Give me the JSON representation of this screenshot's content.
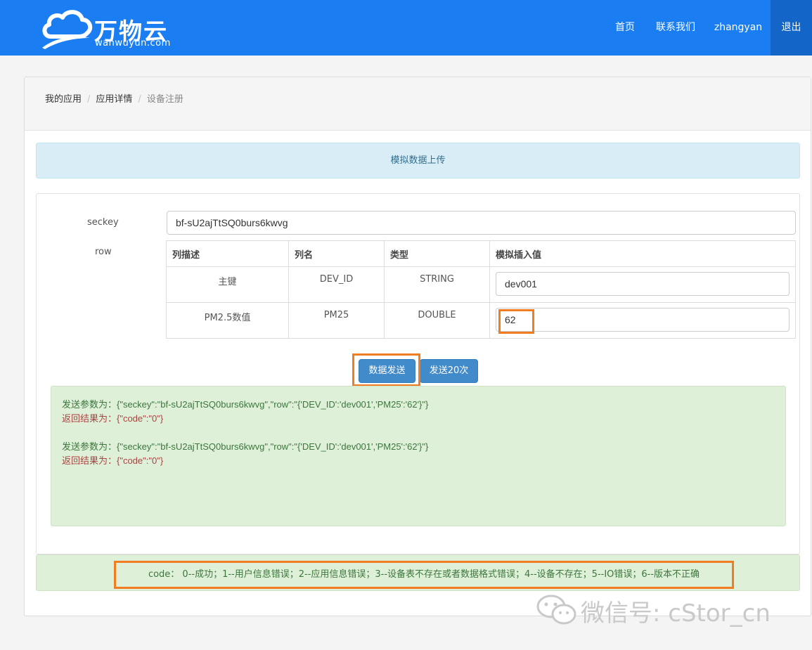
{
  "brand": {
    "name": "万物云",
    "domain": "wanwuyun.com",
    "color": "#1a7ef2"
  },
  "nav": {
    "home": "首页",
    "contact": "联系我们",
    "user": "zhangyan",
    "logout": "退出"
  },
  "breadcrumb": {
    "items": [
      "我的应用",
      "应用详情",
      "设备注册"
    ],
    "separator": "/"
  },
  "panel_title": "模拟数据上传",
  "form": {
    "seckey_label": "seckey",
    "seckey_value": "bf-sU2ajTtSQ0burs6kwvg",
    "row_label": "row",
    "columns": [
      "列描述",
      "列名",
      "类型",
      "模拟插入值"
    ],
    "rows": [
      {
        "desc": "主键",
        "name": "DEV_ID",
        "type": "STRING",
        "value": "dev001"
      },
      {
        "desc": "PM2.5数值",
        "name": "PM25",
        "type": "DOUBLE",
        "value": "62"
      }
    ]
  },
  "buttons": {
    "send": "数据发送",
    "send20": "发送20次"
  },
  "log": [
    {
      "params": "发送参数为：{\"seckey\":\"bf-sU2ajTtSQ0burs6kwvg\",\"row\":\"{'DEV_ID':'dev001','PM25':'62'}\"}",
      "result": "返回结果为：{\"code\":\"0\"}"
    },
    {
      "params": "发送参数为：{\"seckey\":\"bf-sU2ajTtSQ0burs6kwvg\",\"row\":\"{'DEV_ID':'dev001','PM25':'62'}\"}",
      "result": "返回结果为：{\"code\":\"0\"}"
    }
  ],
  "code_legend": "code： 0--成功；1--用户信息错误；2--应用信息错误；3--设备表不存在或者数据格式错误；4--设备不存在；5--IO错误；6--版本不正确",
  "watermark": "微信号: cStor_cn",
  "colors": {
    "highlight": "#f07d22",
    "button": "#428bca",
    "success_bg": "#dff0d8",
    "info_bg": "#d9edf7"
  }
}
